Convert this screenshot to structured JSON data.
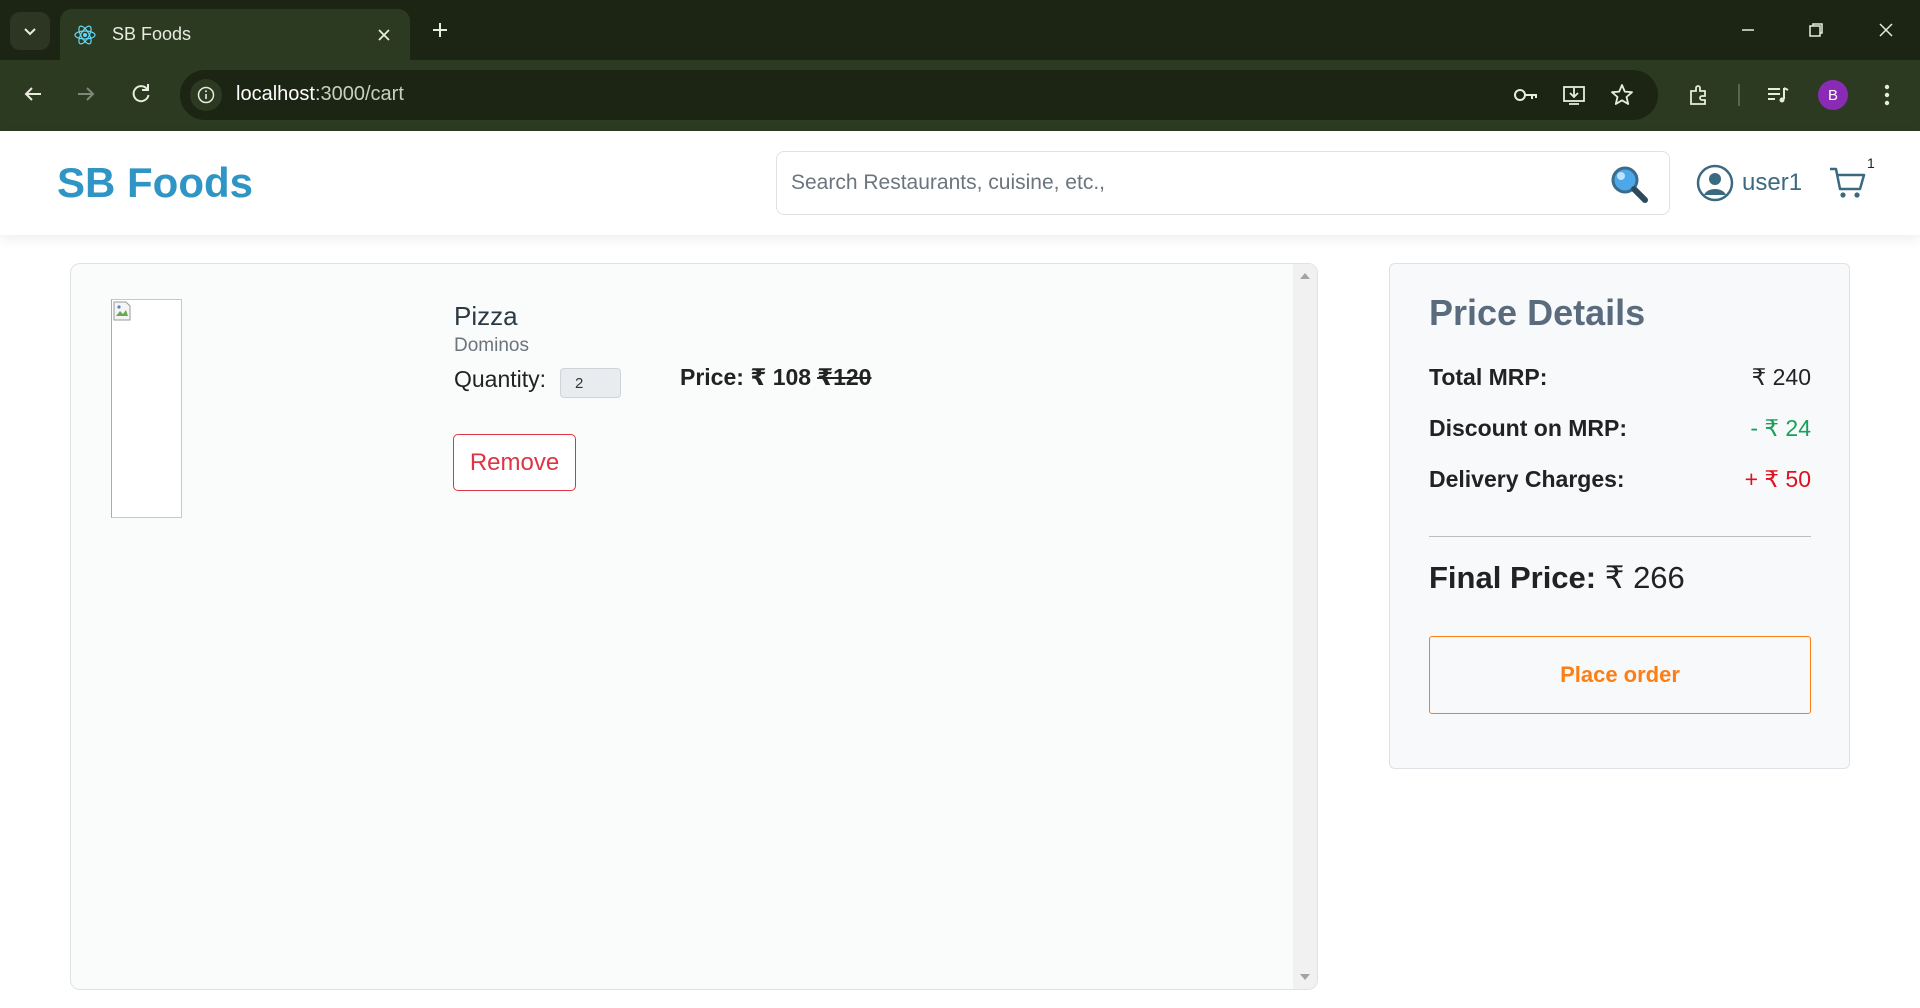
{
  "browser": {
    "tab_title": "SB Foods",
    "url_host": "localhost",
    "url_path": ":3000/cart",
    "profile_initial": "B"
  },
  "header": {
    "brand": "SB Foods",
    "search_placeholder": "Search Restaurants, cuisine, etc.,",
    "username": "user1",
    "cart_count": "1"
  },
  "cart": {
    "items": [
      {
        "name": "Pizza",
        "restaurant": "Dominos",
        "quantity_label": "Quantity:",
        "quantity": "2",
        "price_label": "Price: ₹ 108",
        "original_price": "₹120",
        "remove_label": "Remove"
      }
    ]
  },
  "price_details": {
    "title": "Price Details",
    "total_mrp_label": "Total MRP:",
    "total_mrp_value": "₹ 240",
    "discount_label": "Discount on MRP:",
    "discount_value": "- ₹ 24",
    "delivery_label": "Delivery Charges:",
    "delivery_value": "+ ₹ 50",
    "final_label": "Final Price:",
    "final_value": "₹ 266",
    "order_button": "Place order"
  },
  "colors": {
    "brand": "#2f95c4",
    "remove": "#dc3545",
    "order": "#fd7e14",
    "discount": "#1a9f5b",
    "delivery": "#e0101e"
  }
}
